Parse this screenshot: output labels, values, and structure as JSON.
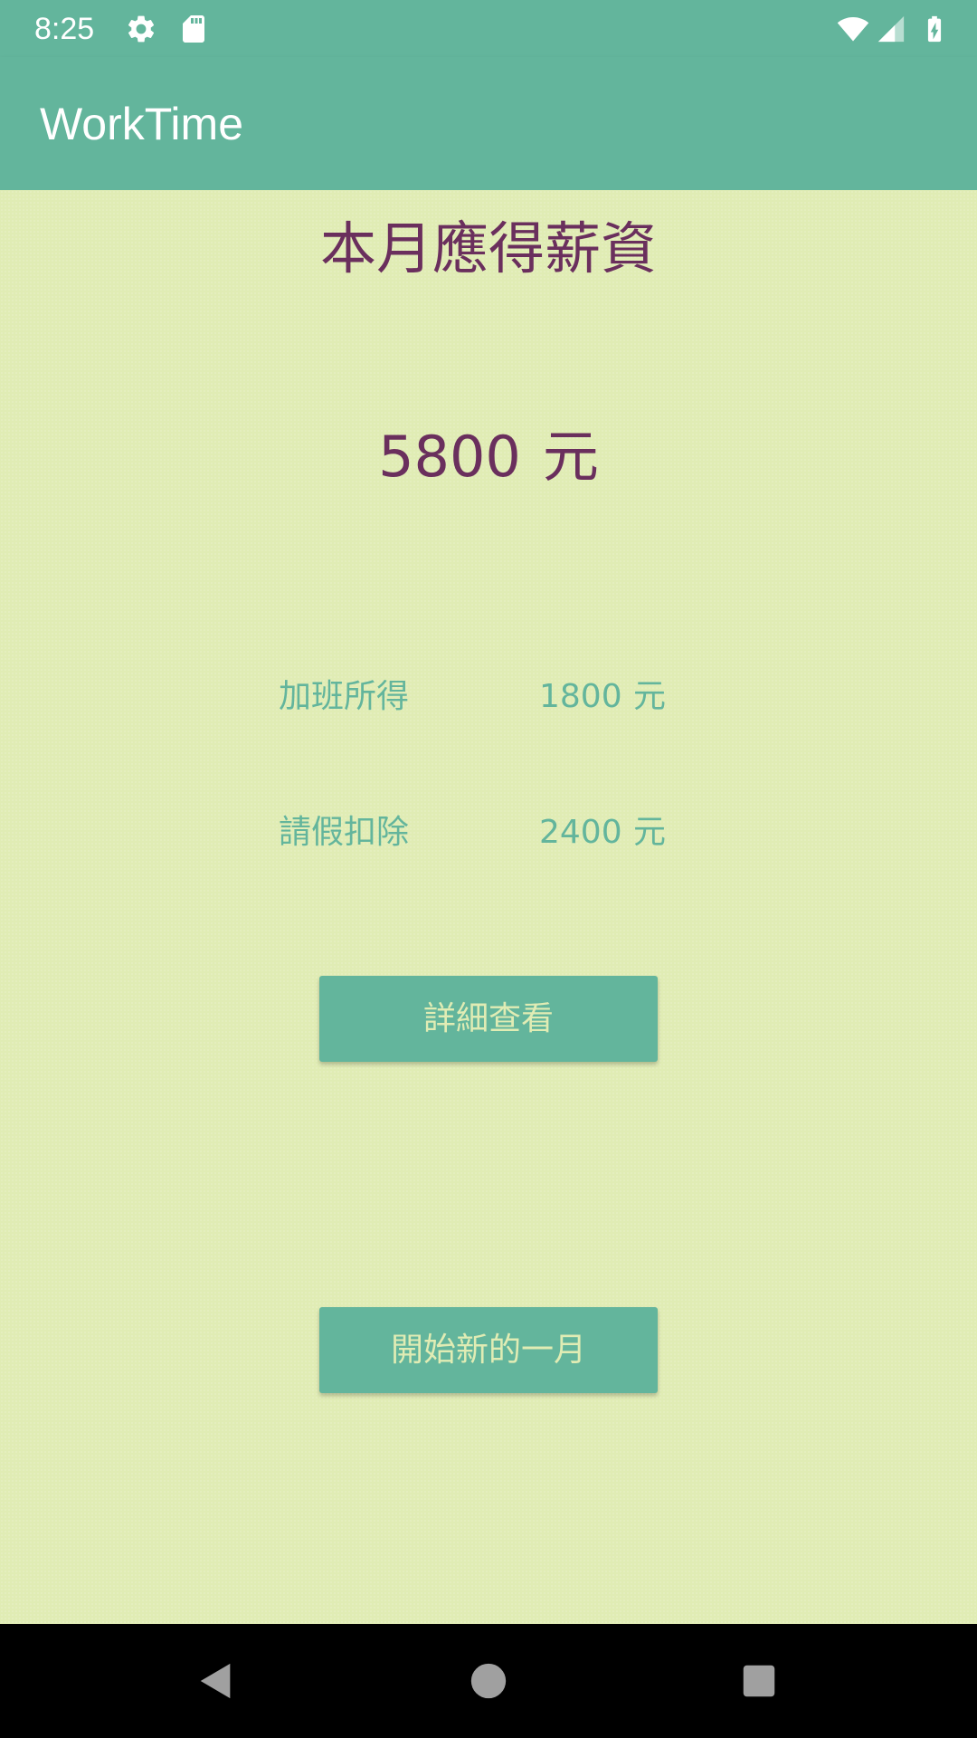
{
  "status_bar": {
    "time": "8:25",
    "icons_left": [
      "gear-icon",
      "sd-card-icon"
    ],
    "icons_right": [
      "wifi-icon",
      "signal-icon",
      "battery-charging-icon"
    ]
  },
  "app_bar": {
    "title": "WorkTime"
  },
  "main": {
    "heading": "本月應得薪資",
    "salary_amount": "5800",
    "salary_unit": "元",
    "overtime": {
      "label": "加班所得",
      "value": "1800",
      "unit": "元"
    },
    "leave": {
      "label": "請假扣除",
      "value": "2400",
      "unit": "元"
    },
    "details_button": "詳細查看",
    "new_month_button": "開始新的一月"
  },
  "nav_bar": {
    "icons": [
      "back-icon",
      "home-icon",
      "recents-icon"
    ]
  },
  "colors": {
    "primary": "#63b59c",
    "background": "#e0ecb4",
    "accent_text": "#6a2f5d"
  }
}
